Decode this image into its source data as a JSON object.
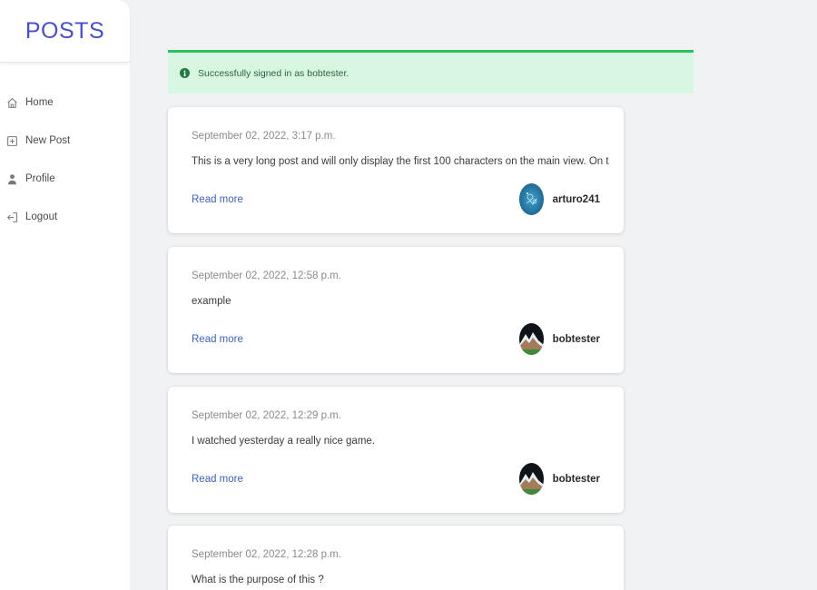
{
  "brand": {
    "title": "POSTS"
  },
  "sidebar": {
    "items": [
      {
        "label": "Home",
        "icon": "home-icon"
      },
      {
        "label": "New Post",
        "icon": "plus-square-icon"
      },
      {
        "label": "Profile",
        "icon": "user-icon"
      },
      {
        "label": "Logout",
        "icon": "logout-icon"
      }
    ]
  },
  "notification": {
    "text": "Successfully signed in as bobtester.",
    "icon": "info-icon",
    "color": "#2fbf61"
  },
  "posts": [
    {
      "date": "September 02, 2022, 3:17 p.m.",
      "body": "This is a very long post and will only display the first 100 characters on the main view. On the Det",
      "read_more": "Read more",
      "author": "arturo241",
      "avatar": "blue-abstract-avatar"
    },
    {
      "date": "September 02, 2022, 12:58 p.m.",
      "body": "example",
      "read_more": "Read more",
      "author": "bobtester",
      "avatar": "mountain-avatar"
    },
    {
      "date": "September 02, 2022, 12:29 p.m.",
      "body": "I watched yesterday a really nice game.",
      "read_more": "Read more",
      "author": "bobtester",
      "avatar": "mountain-avatar"
    },
    {
      "date": "September 02, 2022, 12:28 p.m.",
      "body": "What is the purpose of this ?",
      "read_more": "",
      "author": "",
      "avatar": ""
    }
  ],
  "colors": {
    "brand": "#4a4fc8",
    "link": "#3e63b3",
    "success_bg": "#d8f7e3",
    "success_border": "#2fbf61"
  }
}
